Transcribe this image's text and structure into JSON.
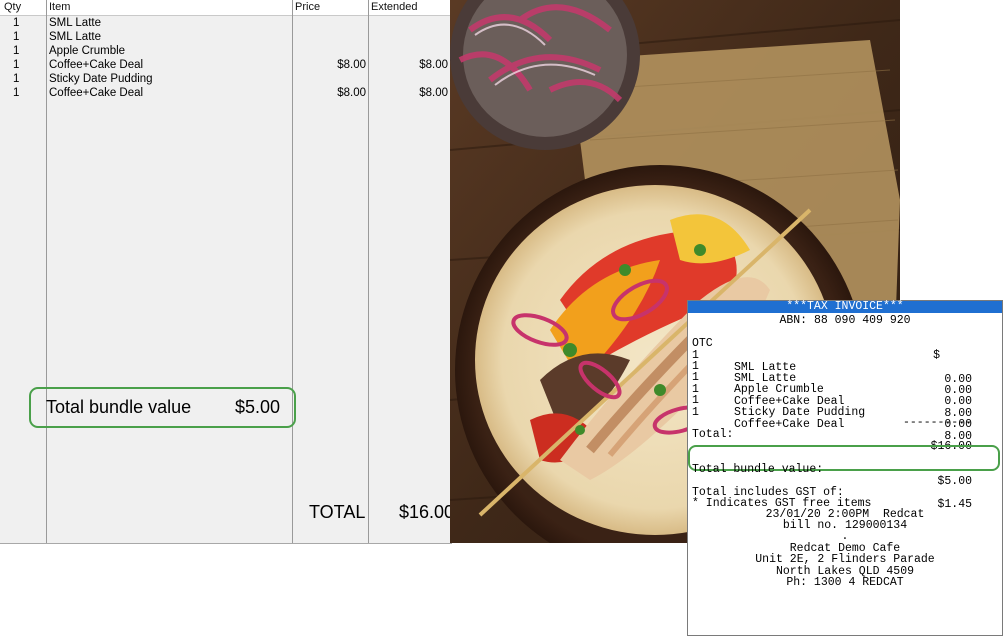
{
  "pos": {
    "headers": {
      "qty": "Qty",
      "item": "Item",
      "price": "Price",
      "extended": "Extended"
    },
    "rows": [
      {
        "qty": "1",
        "item": "SML Latte",
        "price": "",
        "extended": ""
      },
      {
        "qty": "1",
        "item": "SML Latte",
        "price": "",
        "extended": ""
      },
      {
        "qty": "1",
        "item": "Apple Crumble",
        "price": "",
        "extended": ""
      },
      {
        "qty": "1",
        "item": "Coffee+Cake Deal",
        "price": "$8.00",
        "extended": "$8.00"
      },
      {
        "qty": "1",
        "item": "Sticky Date Pudding",
        "price": "",
        "extended": ""
      },
      {
        "qty": "1",
        "item": "Coffee+Cake Deal",
        "price": "$8.00",
        "extended": "$8.00"
      }
    ],
    "bundle_label": "Total bundle value",
    "bundle_value": "$5.00",
    "total_label": "TOTAL",
    "total_value": "$16.00"
  },
  "receipt": {
    "title": "***TAX INVOICE***",
    "abn": "ABN: 88 090 409 920",
    "otc": "OTC",
    "currency": "$",
    "lines": [
      {
        "qty": "1",
        "item": "SML Latte",
        "amount": "0.00"
      },
      {
        "qty": "1",
        "item": "SML Latte",
        "amount": "0.00"
      },
      {
        "qty": "1",
        "item": "Apple Crumble",
        "amount": "0.00"
      },
      {
        "qty": "1",
        "item": "Coffee+Cake Deal",
        "amount": "8.00"
      },
      {
        "qty": "1",
        "item": "Sticky Date Pudding",
        "amount": "0.00"
      },
      {
        "qty": "1",
        "item": "Coffee+Cake Deal",
        "amount": "8.00"
      }
    ],
    "separator": "----------",
    "total_label": "Total:",
    "total_value": "$16.00",
    "bundle_label": "Total bundle value:",
    "bundle_value": "$5.00",
    "gst_label": "Total includes GST of:",
    "gst_value": "$1.45",
    "gst_note": "* Indicates GST free items",
    "datetime": "23/01/20 2:00PM  Redcat",
    "bill": "bill no. 129000134",
    "dot": ".",
    "store_name": "Redcat Demo Cafe",
    "address1": "Unit 2E, 2 Flinders Parade",
    "address2": "North Lakes QLD 4509",
    "phone": "Ph: 1300 4 REDCAT"
  },
  "colors": {
    "highlight": "#4aa04a",
    "receipt_header": "#1f6fd1",
    "grid_bg": "#f0f0f0"
  }
}
